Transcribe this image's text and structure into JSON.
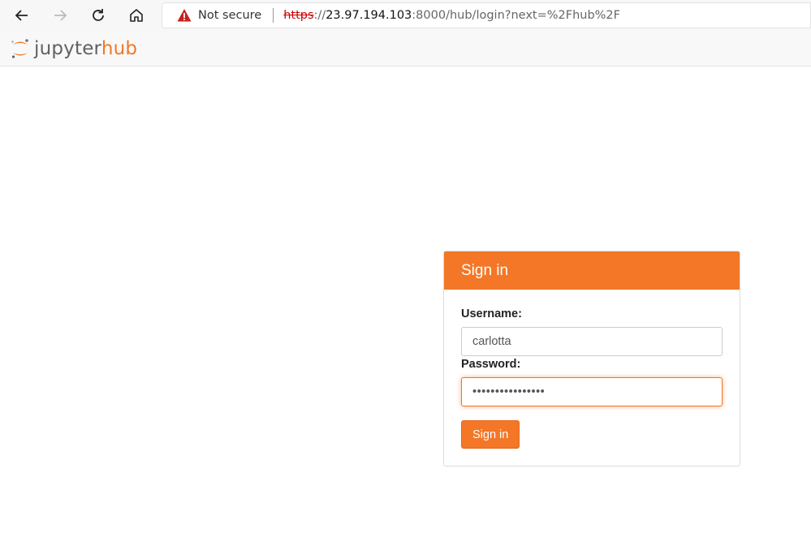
{
  "browser": {
    "security_label": "Not secure",
    "url_scheme": "https",
    "url_sep": "://",
    "url_host": "23.97.194.103",
    "url_rest": ":8000/hub/login?next=%2Fhub%2F",
    "icons": [
      "back-icon",
      "forward-icon",
      "reload-icon",
      "home-icon",
      "warning-icon"
    ]
  },
  "header": {
    "logo_text_1": "jupyter",
    "logo_text_2": "hub",
    "brand_color": "#f37726"
  },
  "login": {
    "title": "Sign in",
    "username_label": "Username:",
    "username_value": "carlotta",
    "password_label": "Password:",
    "password_value": "••••••••••••••••",
    "submit_label": "Sign in"
  }
}
